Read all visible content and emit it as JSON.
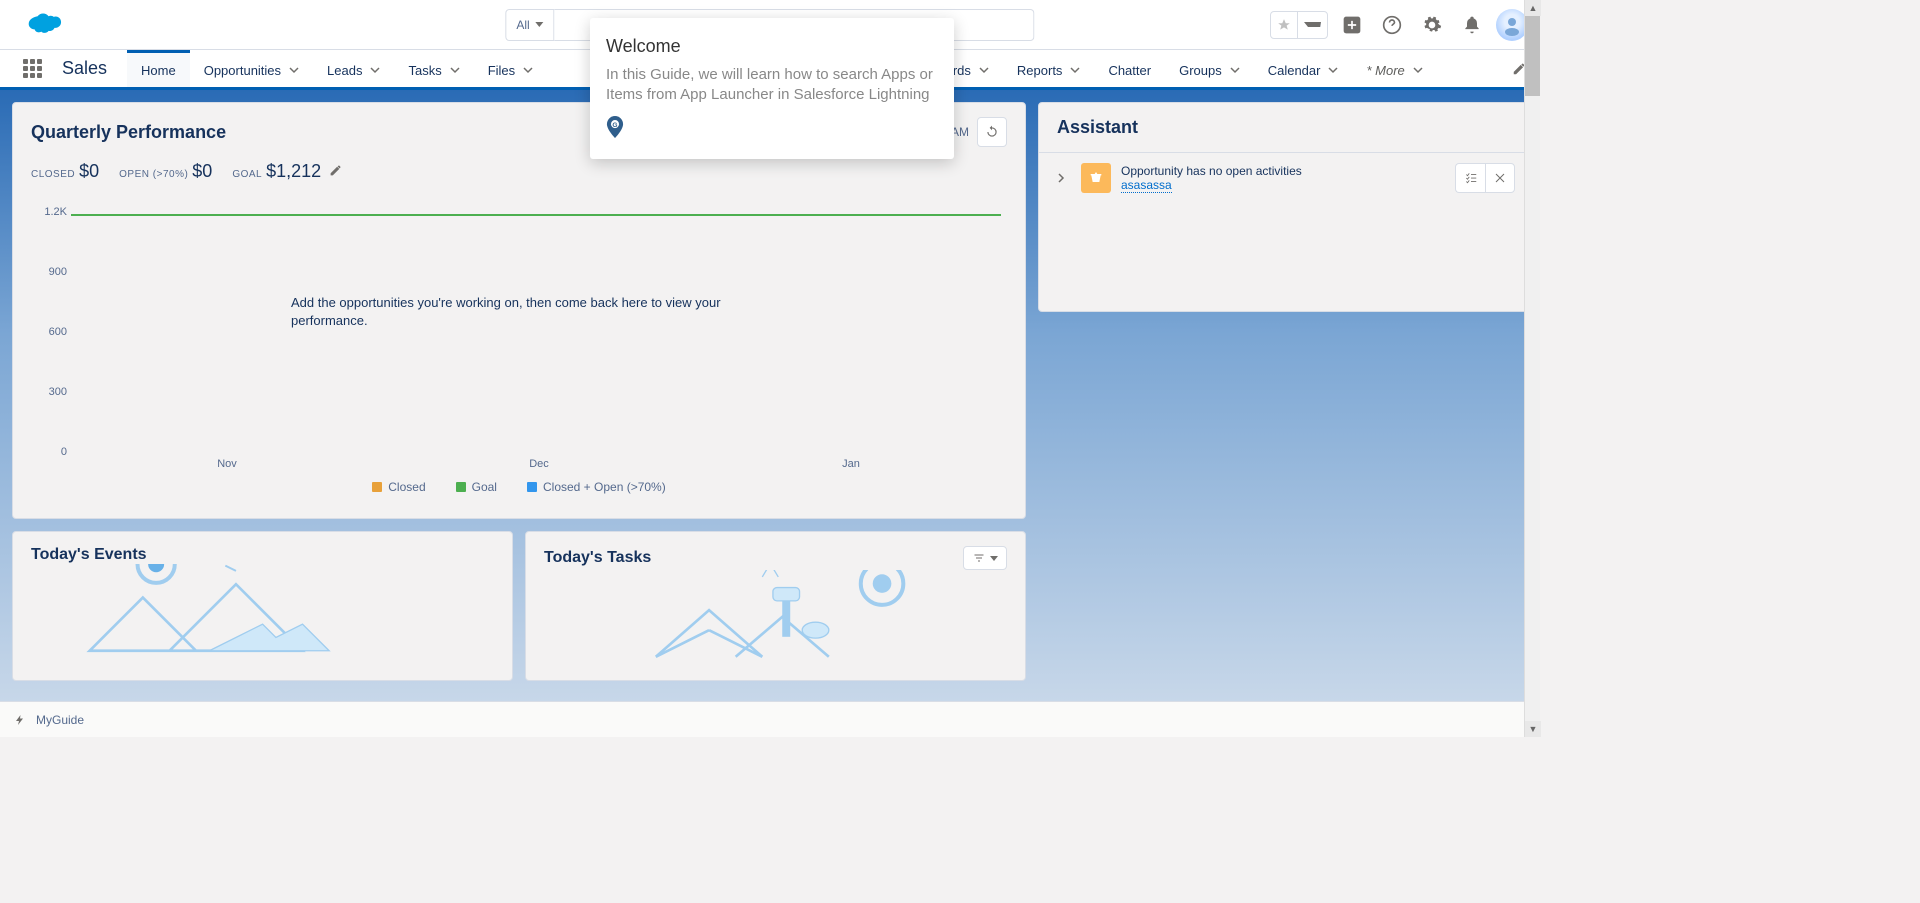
{
  "header": {
    "search_scope": "All",
    "search_placeholder": ""
  },
  "nav": {
    "app_name": "Sales",
    "items": [
      "Home",
      "Opportunities",
      "Leads",
      "Tasks",
      "Files",
      "",
      "",
      "boards",
      "Reports",
      "Chatter",
      "Groups",
      "Calendar"
    ],
    "more": "* More"
  },
  "popover": {
    "title": "Welcome",
    "body": "In this Guide, we will learn how to search Apps or Items from App Launcher in Salesforce Lightning"
  },
  "quarterly": {
    "title": "Quarterly Performance",
    "as_of": "AM",
    "stats": {
      "closed_label": "CLOSED",
      "closed_value": "$0",
      "open_label": "OPEN (>70%)",
      "open_value": "$0",
      "goal_label": "GOAL",
      "goal_value": "$1,212"
    },
    "empty_msg": "Add the opportunities you're working on, then come back here to view your performance."
  },
  "chart_data": {
    "type": "line",
    "title": "Quarterly Performance",
    "xlabel": "",
    "ylabel": "",
    "ylim": [
      0,
      1200
    ],
    "y_ticks": [
      "0",
      "300",
      "600",
      "900",
      "1.2K"
    ],
    "categories": [
      "Nov",
      "Dec",
      "Jan"
    ],
    "series": [
      {
        "name": "Closed",
        "values": [],
        "color": "#e8a13a"
      },
      {
        "name": "Goal",
        "values": [
          1212,
          1212,
          1212
        ],
        "color": "#4caf50"
      },
      {
        "name": "Closed + Open (>70%)",
        "values": [],
        "color": "#3296ed"
      }
    ]
  },
  "events": {
    "title": "Today's Events"
  },
  "tasks": {
    "title": "Today's Tasks"
  },
  "assistant": {
    "title": "Assistant",
    "item_text": "Opportunity has no open activities",
    "item_link": "asasassa"
  },
  "footer": {
    "label": "MyGuide"
  }
}
